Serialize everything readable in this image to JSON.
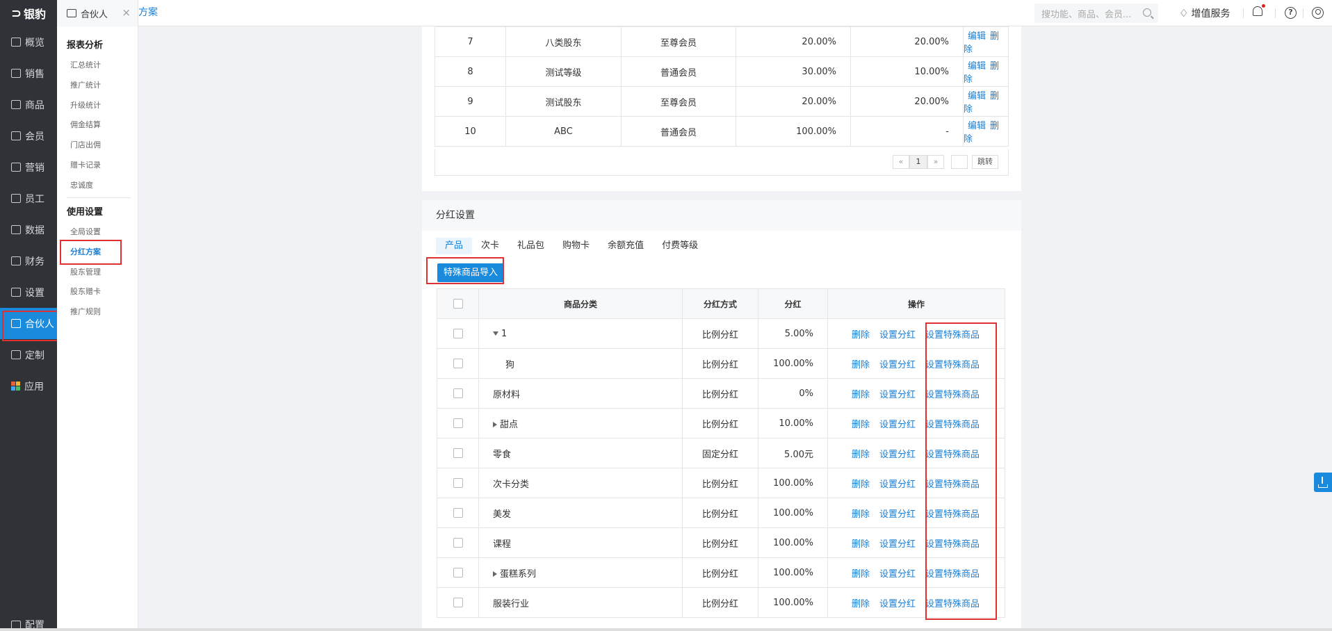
{
  "brand": {
    "name": "银豹"
  },
  "topbar": {
    "tab_partner": "合伙人",
    "tab_close": "×",
    "tab_plan": "方案",
    "search_placeholder": "搜功能、商品、会员...",
    "value_added": "增值服务"
  },
  "sidebar": {
    "items": [
      {
        "label": "概览",
        "icon": "home-icon"
      },
      {
        "label": "销售",
        "icon": "sales-icon"
      },
      {
        "label": "商品",
        "icon": "goods-icon"
      },
      {
        "label": "会员",
        "icon": "member-icon"
      },
      {
        "label": "营销",
        "icon": "marketing-icon"
      },
      {
        "label": "员工",
        "icon": "staff-icon"
      },
      {
        "label": "数据",
        "icon": "data-icon"
      },
      {
        "label": "财务",
        "icon": "finance-icon"
      },
      {
        "label": "设置",
        "icon": "settings-icon"
      },
      {
        "label": "合伙人",
        "icon": "partner-icon"
      },
      {
        "label": "定制",
        "icon": "custom-icon"
      },
      {
        "label": "应用",
        "icon": "apps-icon"
      }
    ],
    "config": "配置"
  },
  "subsidebar": {
    "group1": "报表分析",
    "group1_items": [
      "汇总统计",
      "推广统计",
      "升级统计",
      "佣金结算",
      "门店出佣",
      "赠卡记录",
      "忠诚度"
    ],
    "group2": "使用设置",
    "group2_items": [
      "全局设置",
      "分红方案",
      "股东管理",
      "股东赠卡",
      "推广规则"
    ]
  },
  "level_table": {
    "rows": [
      {
        "no": "7",
        "name": "八类股东",
        "level": "至尊会员",
        "rate1": "20.00%",
        "rate2": "20.00%"
      },
      {
        "no": "8",
        "name": "测试等级",
        "level": "普通会员",
        "rate1": "30.00%",
        "rate2": "10.00%"
      },
      {
        "no": "9",
        "name": "测试股东",
        "level": "至尊会员",
        "rate1": "20.00%",
        "rate2": "20.00%"
      },
      {
        "no": "10",
        "name": "ABC",
        "level": "普通会员",
        "rate1": "100.00%",
        "rate2": "-"
      }
    ],
    "edit": "编辑",
    "delete": "删除",
    "pager": {
      "prev": "«",
      "page": "1",
      "next": "»",
      "jump": "跳转"
    }
  },
  "dividend": {
    "title": "分红设置",
    "tabs": [
      "产品",
      "次卡",
      "礼品包",
      "购物卡",
      "余额充值",
      "付费等级"
    ],
    "import_button": "特殊商品导入",
    "headers": {
      "category": "商品分类",
      "method": "分红方式",
      "dividend": "分红",
      "ops": "操作"
    },
    "op_delete": "删除",
    "op_set": "设置分红",
    "op_special": "设置特殊商品",
    "rows": [
      {
        "category": "1",
        "expand": "down",
        "method": "比例分红",
        "value": "5.00%"
      },
      {
        "category": "狗",
        "expand": "child",
        "method": "比例分红",
        "value": "100.00%"
      },
      {
        "category": "原材料",
        "expand": "none",
        "method": "比例分红",
        "value": "0%"
      },
      {
        "category": "甜点",
        "expand": "right",
        "method": "比例分红",
        "value": "10.00%"
      },
      {
        "category": "零食",
        "expand": "none",
        "method": "固定分红",
        "value": "5.00元"
      },
      {
        "category": "次卡分类",
        "expand": "none",
        "method": "比例分红",
        "value": "100.00%"
      },
      {
        "category": "美发",
        "expand": "none",
        "method": "比例分红",
        "value": "100.00%"
      },
      {
        "category": "课程",
        "expand": "none",
        "method": "比例分红",
        "value": "100.00%"
      },
      {
        "category": "蛋糕系列",
        "expand": "right",
        "method": "比例分红",
        "value": "100.00%"
      },
      {
        "category": "服装行业",
        "expand": "none",
        "method": "比例分红",
        "value": "100.00%"
      }
    ]
  }
}
